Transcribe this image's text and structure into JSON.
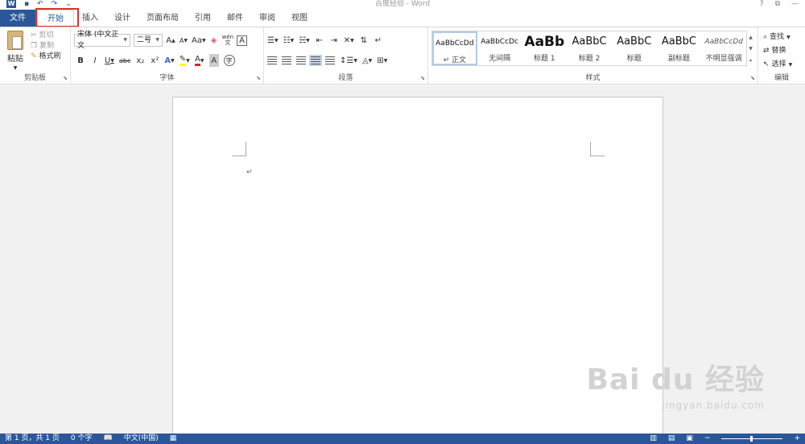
{
  "title_bar": {
    "doc_title": "百度经验 - Word",
    "app_icon": "W",
    "qat": [
      "save-icon",
      "undo-icon",
      "redo-icon",
      "customize-qat-icon"
    ],
    "window_buttons": [
      "?",
      "⧉",
      "—"
    ]
  },
  "tabs": [
    {
      "label": "文件",
      "kind": "file"
    },
    {
      "label": "开始",
      "kind": "active"
    },
    {
      "label": "插入"
    },
    {
      "label": "设计"
    },
    {
      "label": "页面布局"
    },
    {
      "label": "引用"
    },
    {
      "label": "邮件"
    },
    {
      "label": "审阅"
    },
    {
      "label": "视图"
    }
  ],
  "ribbon": {
    "clipboard": {
      "label": "剪贴板",
      "paste": "粘贴",
      "cut": "剪切",
      "copy": "复制",
      "format_painter": "格式刷"
    },
    "font": {
      "label": "字体",
      "font_name": "宋体 (中文正文",
      "font_size": "二号",
      "grow": "A",
      "shrink": "A",
      "change_case": "Aa",
      "bold": "B",
      "italic": "I",
      "underline": "U",
      "strikethrough": "abc",
      "subscript": "x₂",
      "superscript": "x²",
      "text_effects": "A",
      "font_color": "A",
      "char_shading": "A",
      "pinyin": "wén",
      "char_border": "A",
      "enclose": "字"
    },
    "paragraph": {
      "label": "段落"
    },
    "styles": {
      "label": "样式",
      "items": [
        {
          "sample": "AaBbCcDd",
          "name": "↵ 正文",
          "active": true
        },
        {
          "sample": "AaBbCcDc",
          "name": "无间隔"
        },
        {
          "sample": "AaBb",
          "name": "标题 1",
          "big": true
        },
        {
          "sample": "AaBbC",
          "name": "标题 2"
        },
        {
          "sample": "AaBbC",
          "name": "标题"
        },
        {
          "sample": "AaBbC",
          "name": "副标题"
        },
        {
          "sample": "AaBbCcDd",
          "name": "不明显强调",
          "italic": true
        }
      ]
    },
    "editing": {
      "label": "编辑",
      "find": "查找",
      "replace": "替换",
      "select": "选择"
    }
  },
  "document": {
    "paragraph_mark": "↵"
  },
  "watermark": {
    "logo": "Bai du 经验",
    "url": "jingyan.baidu.com"
  },
  "status_bar": {
    "page": "第 1 页，共 1 页",
    "words": "0 个字",
    "lang": "中文(中国)"
  },
  "colors": {
    "accent": "#2b579a",
    "highlight_box": "#e0302c",
    "font_color_bar": "#e02020",
    "highlight_color_bar": "#ffff00"
  }
}
